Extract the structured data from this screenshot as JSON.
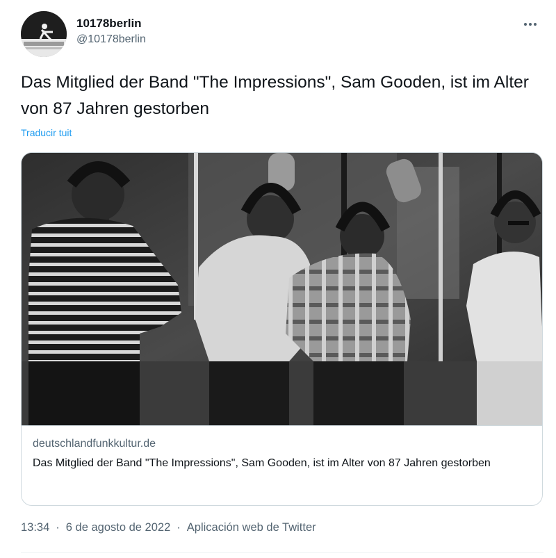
{
  "user": {
    "display_name": "10178berlin",
    "handle": "@10178berlin"
  },
  "tweet": {
    "text": "Das Mitglied der Band \"The Impressions\", Sam Gooden, ist im Alter von 87 Jahren gestorben",
    "translate_label": "Traducir tuit"
  },
  "card": {
    "domain": "deutschlandfunkkultur.de",
    "title": "Das Mitglied der Band \"The Impressions\", Sam Gooden, ist im Alter von 87 Jahren gestorben"
  },
  "meta": {
    "time": "13:34",
    "separator": "·",
    "date": "6 de agosto de 2022",
    "source": "Aplicación web de Twitter"
  },
  "icons": {
    "more": "more-horizontal-icon"
  },
  "colors": {
    "text": "#0f1419",
    "secondary": "#536471",
    "link": "#1d9bf0",
    "border": "#cfd9de"
  }
}
